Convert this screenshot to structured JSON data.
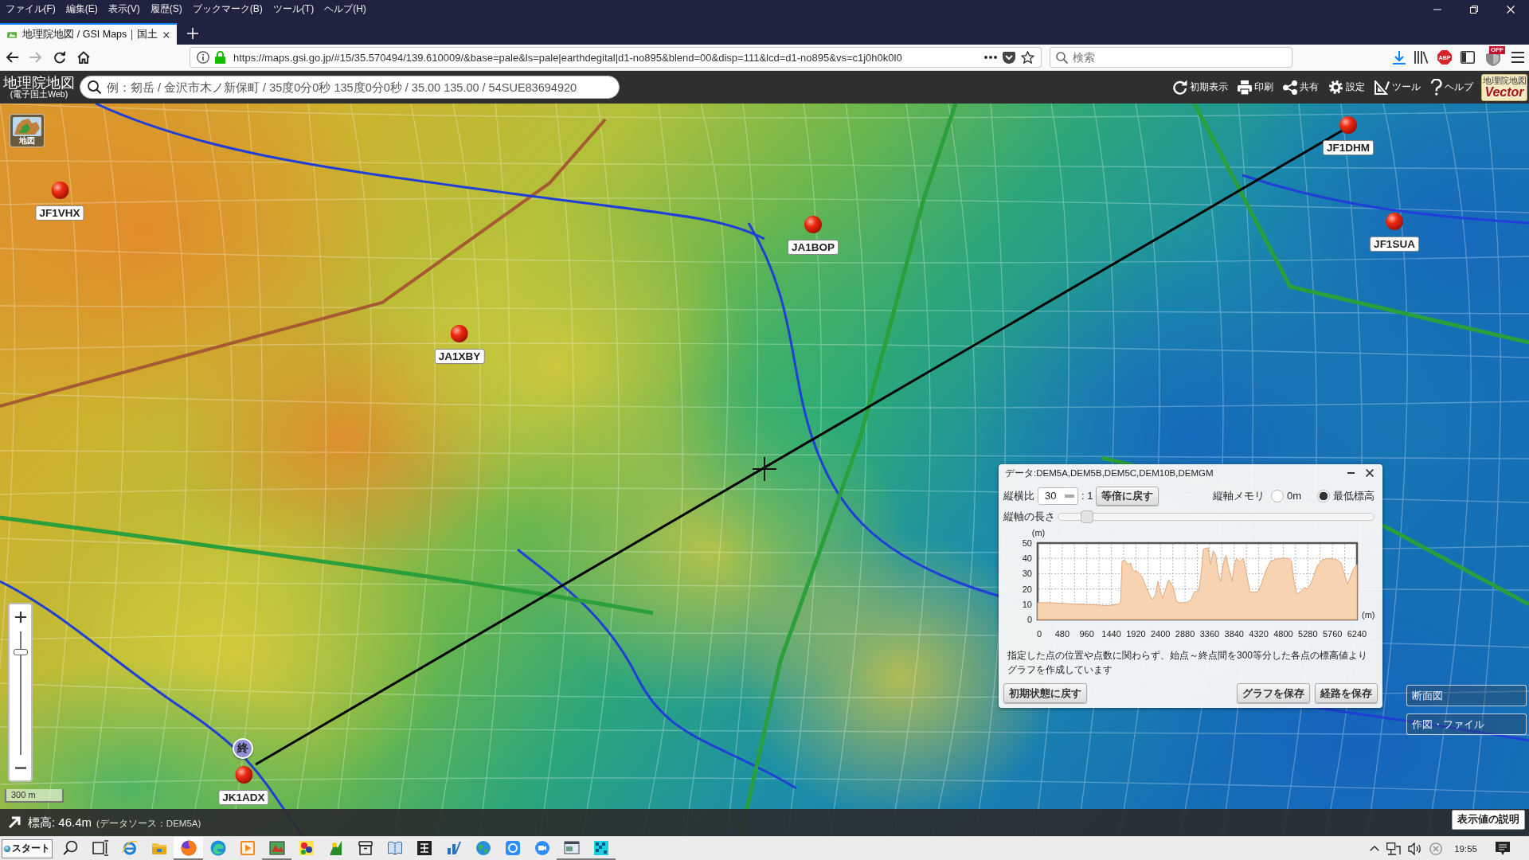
{
  "browser": {
    "menu": [
      "ファイル(F)",
      "編集(E)",
      "表示(V)",
      "履歴(S)",
      "ブックマーク(B)",
      "ツール(T)",
      "ヘルプ(H)"
    ],
    "tabs": [
      {
        "title": "地理院地図 / GSI Maps｜国土",
        "selected": true
      }
    ],
    "navigation": [
      {
        "kind": "back",
        "disabled": false
      },
      {
        "kind": "forward",
        "disabled": true
      },
      {
        "kind": "reload",
        "disabled": false
      },
      {
        "kind": "home",
        "disabled": false
      }
    ],
    "address": "https://maps.gsi.go.jp/#15/35.570494/139.610009/&base=pale&ls=pale|earthdegital|d1-no895&blend=00&disp=111&lcd=d1-no895&vs=c1j0h0k0l0",
    "search": {
      "placeholder": "検索"
    },
    "adblock_badge": "ABP",
    "extension_badge": "OFF"
  },
  "header": {
    "logo": "地理院地図",
    "logo_subtitle": "(電子国土Web)",
    "search": {
      "placeholder": "例：剱岳 / 金沢市木ノ新保町 / 35度0分0秒 135度0分0秒 / 35.00 135.00 / 54SUE83694920"
    },
    "tools": [
      {
        "kind": "reset",
        "label": "初期表示"
      },
      {
        "kind": "print",
        "label": "印刷"
      },
      {
        "kind": "share",
        "label": "共有"
      },
      {
        "kind": "settings",
        "label": "設定"
      },
      {
        "kind": "tools",
        "label": "ツール"
      },
      {
        "kind": "help",
        "label": "ヘルプ"
      }
    ],
    "badge": {
      "title": "地理院地図",
      "subtitle": "Vector"
    }
  },
  "map": {
    "basemap_button": "地図",
    "markers": [
      {
        "label": "JF1VHX"
      },
      {
        "label": "JA1BOP"
      },
      {
        "label": "JA1XBY"
      },
      {
        "label": "JF1DHM"
      },
      {
        "label": "JF1SUA"
      },
      {
        "label": "JK1ADX"
      }
    ],
    "end_marker": "終",
    "zoom": {
      "level": 0.83
    },
    "scale": "300 m",
    "side_buttons": [
      "断面図",
      "作図・ファイル"
    ]
  },
  "profile": {
    "title": "データ:DEM5A,DEM5B,DEM5C,DEM10B,DEMGM",
    "aspect": {
      "label": "縦横比",
      "value": "30",
      "suffix": ": 1",
      "reset_button": "等倍に戻す"
    },
    "axis_memory": {
      "label": "縦軸メモリ",
      "options": [
        {
          "label": "0m",
          "selected": false
        },
        {
          "label": "最低標高",
          "selected": true
        }
      ]
    },
    "axis_length": {
      "label": "縦軸の長さ",
      "level": 0.09
    },
    "chart_data": {
      "type": "area",
      "xlabel": "(m)",
      "ylabel": "(m)",
      "x": [
        0,
        230,
        500,
        830,
        1170,
        1370,
        1570,
        1620,
        1650,
        1700,
        1760,
        1820,
        1860,
        1960,
        2040,
        2110,
        2200,
        2240,
        2300,
        2350,
        2400,
        2440,
        2500,
        2560,
        2620,
        2660,
        2710,
        2760,
        2900,
        3000,
        3060,
        3150,
        3200,
        3240,
        3330,
        3380,
        3430,
        3480,
        3530,
        3580,
        3630,
        3680,
        3740,
        3800,
        3840,
        3880,
        3950,
        4020,
        4080,
        4150,
        4300,
        4360,
        4460,
        4550,
        4700,
        4910,
        4960,
        5010,
        5060,
        5130,
        5210,
        5280,
        5360,
        5460,
        5560,
        5690,
        5860,
        5930,
        5990,
        6060,
        6110,
        6170,
        6240
      ],
      "series": [
        {
          "color": "#f7d3b2",
          "values": [
            11,
            11,
            10.5,
            10,
            9.5,
            9,
            10,
            11,
            38,
            39,
            36,
            37,
            32,
            31,
            28,
            22,
            15,
            13,
            16,
            25,
            18,
            14,
            20,
            26,
            23,
            20,
            12,
            11,
            11,
            13,
            18,
            19,
            32,
            46,
            47,
            36,
            45,
            42,
            30,
            25,
            37,
            42,
            33,
            25,
            35,
            40,
            38,
            40,
            30,
            18,
            18,
            22,
            32,
            38,
            40,
            40,
            38,
            25,
            17,
            18,
            21,
            20,
            25,
            35,
            39,
            40,
            39,
            37,
            30,
            23,
            28,
            33,
            36
          ]
        }
      ],
      "xlim": [
        0,
        6240
      ],
      "ylim": [
        0,
        50
      ],
      "xticks": [
        0,
        480,
        960,
        1440,
        1920,
        2400,
        2880,
        3360,
        3840,
        4320,
        4800,
        5280,
        5760,
        6240
      ],
      "yticks": [
        0,
        10,
        20,
        30,
        40,
        50
      ],
      "grid": true
    },
    "note": "指定した点の位置や点数に関わらず、始点～終点間を300等分した各点の標高値よりグラフを作成しています",
    "buttons": [
      "初期状態に戻す",
      "グラフを保存",
      "経路を保存"
    ]
  },
  "status": {
    "elevation": "標高: 46.4m",
    "source": "(データソース：DEM5A)",
    "help_button": "表示値の説明"
  },
  "taskbar": {
    "start": "スタート",
    "items": [
      {
        "kind": "search",
        "running": false,
        "active": false
      },
      {
        "kind": "taskview",
        "running": false,
        "active": false
      },
      {
        "kind": "ie",
        "running": false,
        "active": false
      },
      {
        "kind": "explorer",
        "running": false,
        "active": false
      },
      {
        "kind": "firefox",
        "running": true,
        "active": true
      },
      {
        "kind": "edge",
        "running": false,
        "active": false
      },
      {
        "kind": "media",
        "running": false,
        "active": false
      },
      {
        "kind": "paint",
        "running": true,
        "active": false
      },
      {
        "kind": "colorful",
        "running": false,
        "active": false
      },
      {
        "kind": "figure",
        "running": false,
        "active": false
      },
      {
        "kind": "archive",
        "running": false,
        "active": false
      },
      {
        "kind": "book",
        "running": false,
        "active": false
      },
      {
        "kind": "tile",
        "running": false,
        "active": false
      },
      {
        "kind": "chart",
        "running": false,
        "active": false
      },
      {
        "kind": "globe",
        "running": false,
        "active": false
      },
      {
        "kind": "circle",
        "running": false,
        "active": false
      },
      {
        "kind": "video",
        "running": false,
        "active": false
      },
      {
        "kind": "window",
        "running": true,
        "active": false
      },
      {
        "kind": "pattern",
        "running": true,
        "active": false
      }
    ],
    "clock": "19:55"
  }
}
